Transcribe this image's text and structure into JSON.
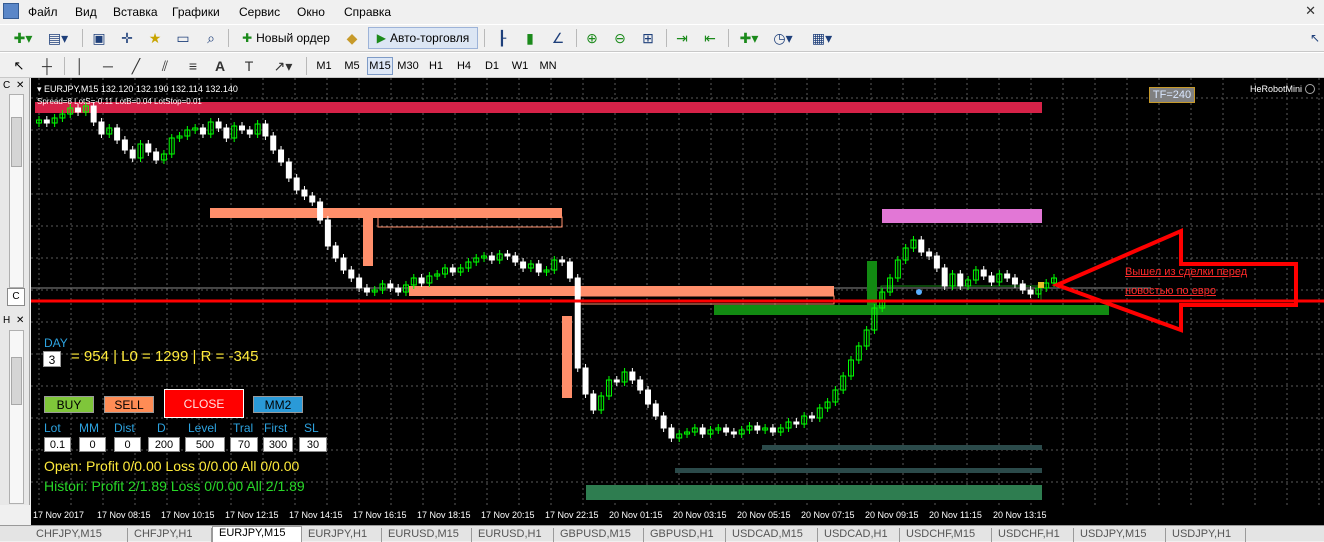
{
  "menu": [
    "Файл",
    "Вид",
    "Вставка",
    "Графики",
    "Сервис",
    "Окно",
    "Справка"
  ],
  "toolbar": {
    "new_order": "Новый ордер",
    "auto_trading": "Авто-торговля"
  },
  "timeframes": [
    "M1",
    "M5",
    "M15",
    "M30",
    "H1",
    "H4",
    "D1",
    "W1",
    "MN"
  ],
  "active_timeframe": "M15",
  "chart": {
    "header": "EURJPY,M15  132.120 132.190 132.114 132.140",
    "info": "Spread=8  LotS=-0.11  LotB=0.04  LotStop=0.01",
    "ea_name": "HeRobotMini",
    "tf_label": "TF=240",
    "annotation_line1": "Вышел из сделки перед",
    "annotation_line2": "новостью по евро"
  },
  "panel": {
    "day_label": "DAY",
    "day_value": "3",
    "stats": "= 954 | L0 = 1299 | R = -345",
    "buy": "BUY",
    "sell": "SELL",
    "close": "CLOSE",
    "mm2": "MM2",
    "labels": [
      "Lot",
      "MM",
      "Dist",
      "D",
      "Level",
      "Tral",
      "First",
      "SL"
    ],
    "values": [
      "0.1",
      "0",
      "0",
      "200",
      "500",
      "70",
      "300",
      "30"
    ],
    "open_line": "Open:  Profit 0/0.00  Loss 0/0.00  All 0/0.00",
    "history_line": "Histori:  Profit 2/1.89  Loss 0/0.00  All 2/1.89"
  },
  "time_axis": [
    "17 Nov 2017",
    "17 Nov 08:15",
    "17 Nov 10:15",
    "17 Nov 12:15",
    "17 Nov 14:15",
    "17 Nov 16:15",
    "17 Nov 18:15",
    "17 Nov 20:15",
    "17 Nov 22:15",
    "20 Nov 01:15",
    "20 Nov 03:15",
    "20 Nov 05:15",
    "20 Nov 07:15",
    "20 Nov 09:15",
    "20 Nov 11:15",
    "20 Nov 13:15"
  ],
  "tabs": [
    "CHFJPY,M15",
    "CHFJPY,H1",
    "EURJPY,M15",
    "EURJPY,H1",
    "EURUSD,M15",
    "EURUSD,H1",
    "GBPUSD,M15",
    "GBPUSD,H1",
    "USDCAD,M15",
    "USDCAD,H1",
    "USDCHF,M15",
    "USDCHF,H1",
    "USDJPY,M15",
    "USDJPY,H1"
  ],
  "active_tab": "EURJPY,M15",
  "colors": {
    "up_candle": "#00ff00",
    "down_candle": "#ffffff",
    "grid": "#5a5a5a",
    "resistance": "#d62248",
    "level_orange": "#ff8f6b",
    "level_magenta": "#e277d6",
    "level_green": "#128a12",
    "price_line": "#ff0000",
    "arrow": "#ff0000",
    "panel_yellow": "#ffeb3b",
    "panel_green": "#28d828"
  }
}
